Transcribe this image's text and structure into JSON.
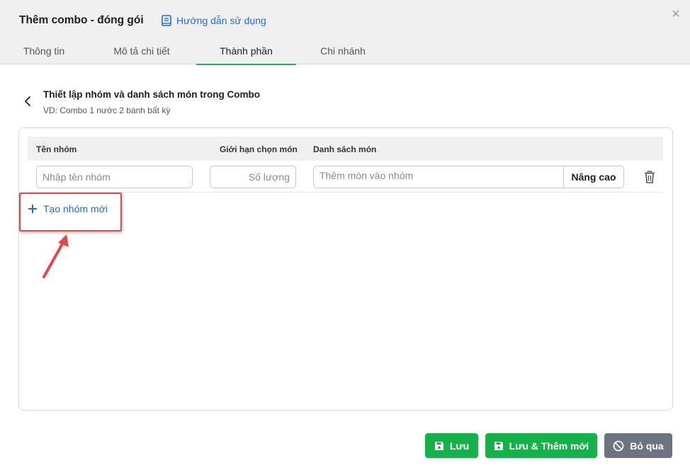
{
  "dialog": {
    "title": "Thêm combo - đóng gói",
    "guide_link": "Hướng dẫn sử dụng"
  },
  "tabs": [
    {
      "label": "Thông tin",
      "active": false
    },
    {
      "label": "Mô tả chi tiết",
      "active": false
    },
    {
      "label": "Thành phần",
      "active": true
    },
    {
      "label": "Chi nhánh",
      "active": false
    }
  ],
  "section": {
    "title": "Thiết lập nhóm và danh sách món trong Combo",
    "subtitle": "VD: Combo 1 nước 2 bánh bất kỳ"
  },
  "table": {
    "headers": [
      "Tên nhóm",
      "Giới hạn chọn món",
      "Danh sách món"
    ],
    "row": {
      "group_name_placeholder": "Nhập tên nhóm",
      "group_name_value": "",
      "limit_placeholder": "Số lượng",
      "limit_value": "",
      "items_placeholder": "Thêm món vào nhóm",
      "items_value": "",
      "advanced_label": "Nâng cao"
    }
  },
  "add_group_label": "Tạo nhóm mới",
  "footer": {
    "save_label": "Lưu",
    "save_new_label": "Lưu & Thêm mới",
    "cancel_label": "Bỏ qua"
  },
  "colors": {
    "accent_green": "#17b14a",
    "link_blue": "#1a6fd6",
    "highlight_red": "#e54848",
    "cancel_gray": "#6b7480"
  }
}
